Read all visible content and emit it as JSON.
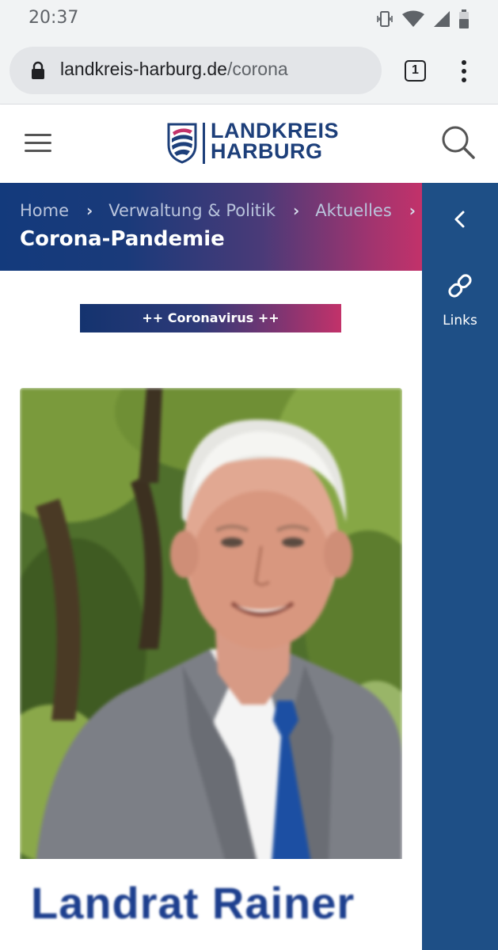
{
  "status_bar": {
    "time": "20:37",
    "icons": [
      "vibrate-icon",
      "wifi-icon",
      "signal-icon",
      "battery-icon"
    ]
  },
  "browser": {
    "url_domain": "landkreis-harburg.de",
    "url_path": "/corona",
    "tab_count": "1"
  },
  "header": {
    "logo_line1": "LANDKREIS",
    "logo_line2": "HARBURG",
    "brand_color": "#1d3f7a"
  },
  "breadcrumb": {
    "items": [
      "Home",
      "Verwaltung & Politik",
      "Aktuelles"
    ],
    "separator": "›",
    "page_title": "Corona-Pandemie"
  },
  "side_panel": {
    "links_label": "Links",
    "color": "#1e4f86"
  },
  "content": {
    "tag_label": "++ Coronavirus ++",
    "photo_caption": "Landrat Rainer"
  },
  "colors": {
    "gradient_start": "#133a7c",
    "gradient_end": "#c2326a"
  }
}
